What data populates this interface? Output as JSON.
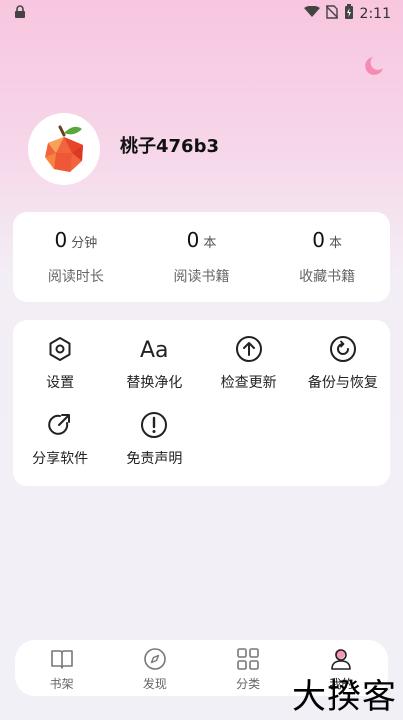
{
  "status": {
    "time": "2:11"
  },
  "profile": {
    "username": "桃子476b3"
  },
  "stats": [
    {
      "value": "0",
      "unit": "分钟",
      "label": "阅读时长"
    },
    {
      "value": "0",
      "unit": "本",
      "label": "阅读书籍"
    },
    {
      "value": "0",
      "unit": "本",
      "label": "收藏书籍"
    }
  ],
  "menu": [
    {
      "label": "设置",
      "icon": "hexagon-settings-icon"
    },
    {
      "label": "替换净化",
      "icon": "font-aa-icon"
    },
    {
      "label": "检查更新",
      "icon": "upload-circle-icon"
    },
    {
      "label": "备份与恢复",
      "icon": "restore-circle-icon"
    },
    {
      "label": "分享软件",
      "icon": "share-icon"
    },
    {
      "label": "免责声明",
      "icon": "alert-circle-icon"
    }
  ],
  "nav": [
    {
      "label": "书架",
      "icon": "book-icon"
    },
    {
      "label": "发现",
      "icon": "compass-icon"
    },
    {
      "label": "分类",
      "icon": "grid-icon"
    },
    {
      "label": "我的",
      "icon": "user-icon",
      "active": true
    }
  ],
  "watermark": "大揆客",
  "colors": {
    "accent": "#f58bb5",
    "background_top": "#f8c6df",
    "card": "#ffffff"
  }
}
